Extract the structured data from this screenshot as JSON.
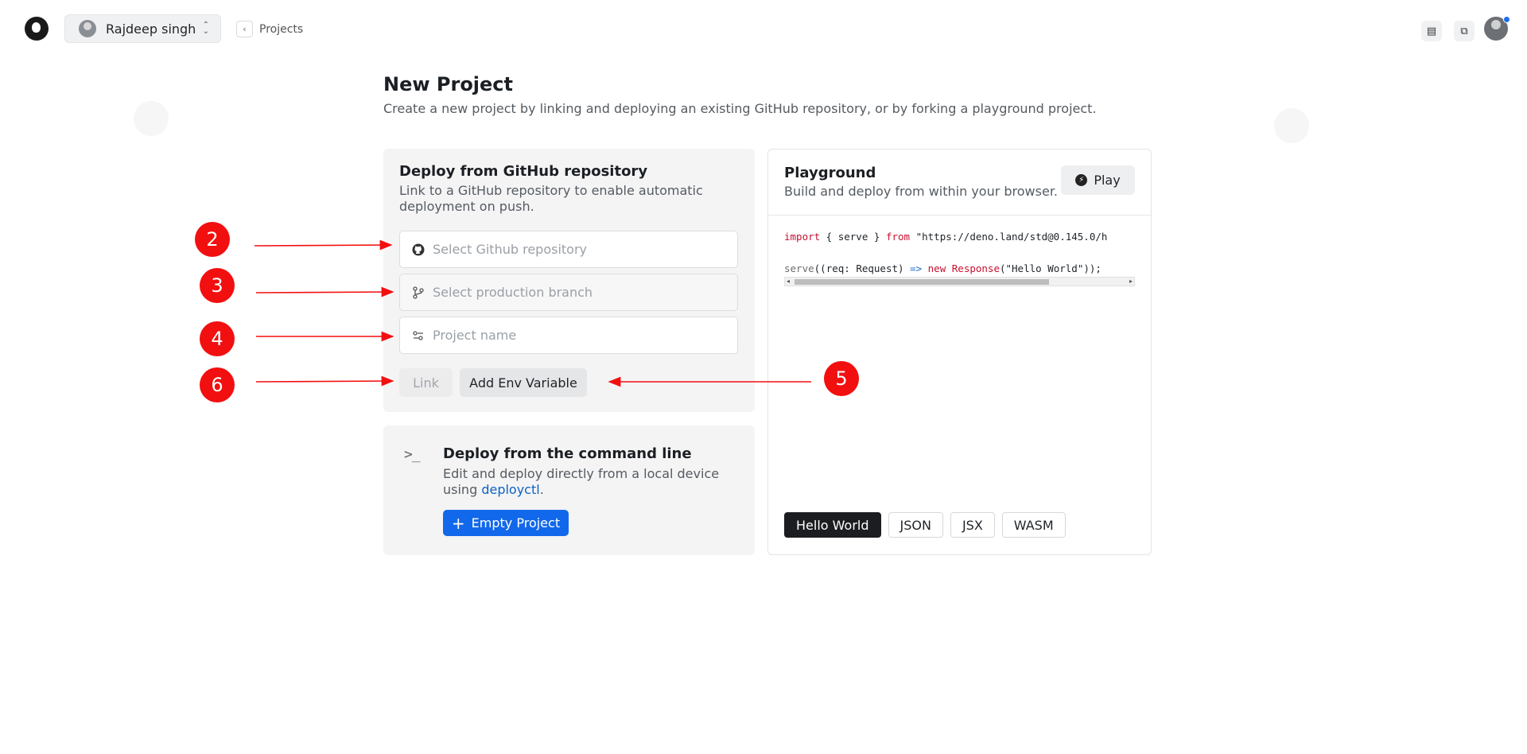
{
  "topbar": {
    "org_name": "Rajdeep singh",
    "crumb_label": "Projects",
    "icons": [
      "deno-logo-icon",
      "chevron-up-down-icon",
      "chevron-left-icon",
      "docs-icon",
      "feedback-icon"
    ]
  },
  "page": {
    "title": "New Project",
    "subtitle": "Create a new project by linking and deploying an existing GitHub repository, or by forking a playground project."
  },
  "github": {
    "title": "Deploy from GitHub repository",
    "description": "Link to a GitHub repository to enable automatic deployment on push.",
    "repo_placeholder": "Select Github repository",
    "branch_placeholder": "Select production branch",
    "name_placeholder": "Project name",
    "link_label": "Link",
    "env_label": "Add Env Variable"
  },
  "cli": {
    "title": "Deploy from the command line",
    "description": "Edit and deploy directly from a local device using",
    "link_text": "deployctl",
    "link_suffix": ".",
    "button_label": "Empty Project"
  },
  "playground": {
    "title": "Playground",
    "description": "Build and deploy from within your browser.",
    "play_label": "Play",
    "code_line1": {
      "kw1": "import",
      "mid": " { serve } ",
      "kw2": "from",
      "str": " \"https://deno.land/std@0.145.0/h"
    },
    "code_line2": {
      "fn": "serve",
      "a": "((req: Request) ",
      "arrow": "=>",
      "sp": " ",
      "kw": "new",
      "sp2": " ",
      "cls": "Response",
      "b": "(\"Hello World\"));"
    },
    "tabs": [
      "Hello World",
      "JSON",
      "JSX",
      "WASM"
    ],
    "active_tab": "Hello World"
  },
  "annotations": {
    "m2": "2",
    "m3": "3",
    "m4": "4",
    "m5": "5",
    "m6": "6",
    "color": "#f20f10"
  },
  "colors": {
    "primary": "#1268ea",
    "link": "#0b62c4",
    "accent_red": "#c8102e"
  }
}
